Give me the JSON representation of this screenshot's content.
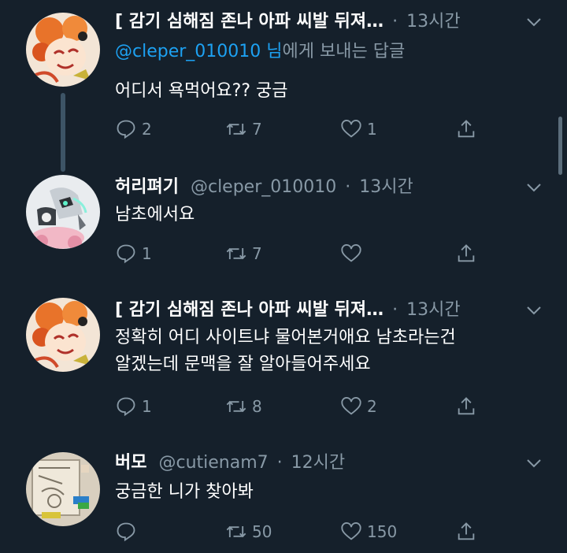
{
  "colors": {
    "background": "#15202b",
    "text": "#ffffff",
    "secondary": "#8899a6",
    "link": "#1da1f2",
    "thread_line": "#3d5466"
  },
  "tweets": [
    {
      "name": "[ 감기 심해짐 존나 아파 씨발 뒤져…",
      "handle": "",
      "dot": "·",
      "time": "13시간",
      "reply_to_mention": "@cleper_010010 님",
      "reply_to_suffix": "에게 보내는 답글",
      "text": "어디서 욕먹어요?? 궁금",
      "replies": "2",
      "retweets": "7",
      "likes": "1",
      "avatar_icon": "orange-cartoon-avatar-icon"
    },
    {
      "name": "허리펴기",
      "handle": "@cleper_010010",
      "dot": "·",
      "time": "13시간",
      "text": "남초에서요",
      "replies": "1",
      "retweets": "7",
      "likes": "",
      "avatar_icon": "robot-character-avatar-icon"
    },
    {
      "name": "[ 감기 심해짐 존나 아파 씨발 뒤져…",
      "handle": "",
      "dot": "·",
      "time": "13시간",
      "text_line1": "정확히 어디 사이트냐 물어본거애요 남초라는건",
      "text_line2": "알겠는데 문맥을 잘 알아들어주세요",
      "replies": "1",
      "retweets": "8",
      "likes": "2",
      "avatar_icon": "orange-cartoon-avatar-icon"
    },
    {
      "name": "버모",
      "handle": "@cutienam7",
      "dot": "·",
      "time": "12시간",
      "text": "궁금한 니가 찾아봐",
      "replies": "",
      "retweets": "50",
      "likes": "150",
      "avatar_icon": "sketch-drawing-avatar-icon"
    }
  ]
}
